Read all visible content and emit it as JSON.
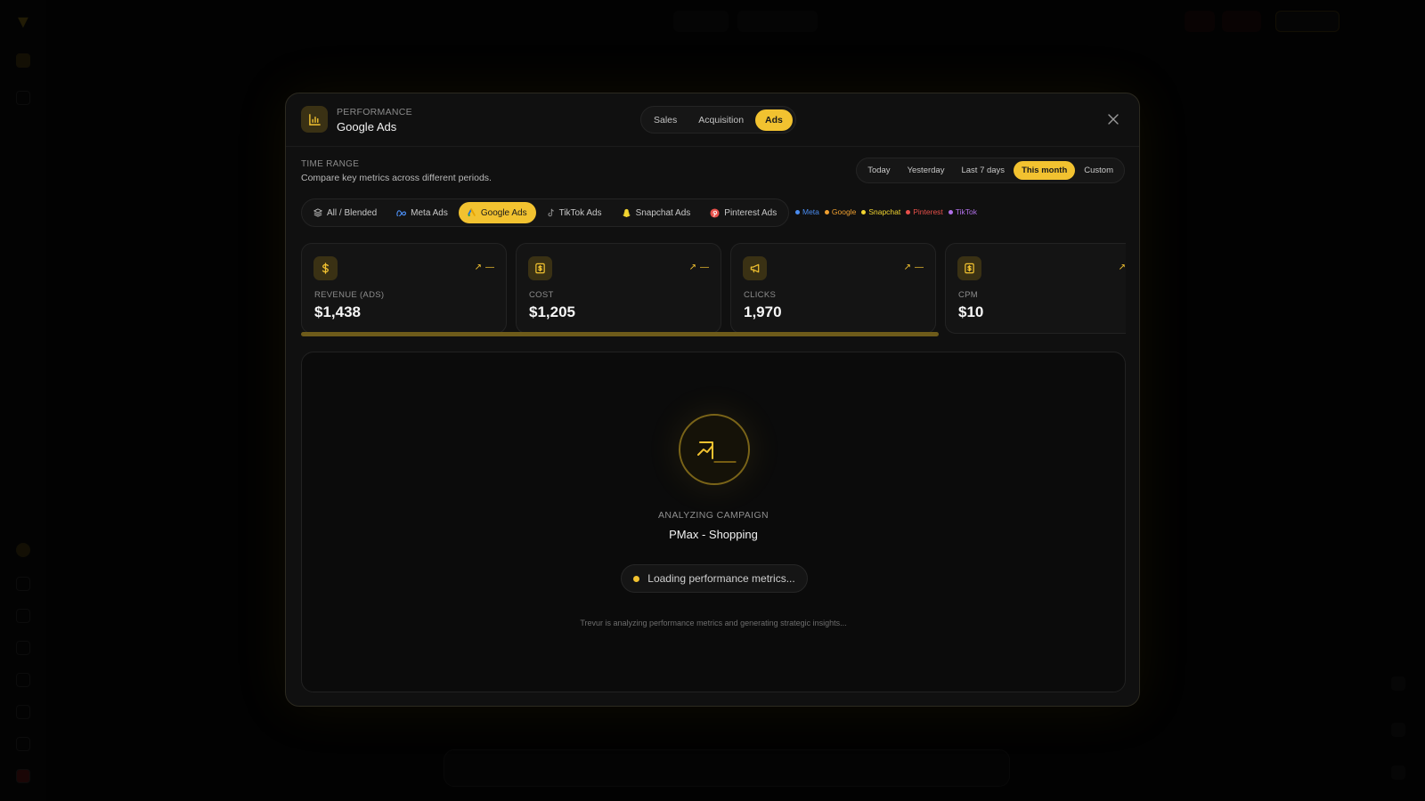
{
  "header": {
    "kicker": "PERFORMANCE",
    "title": "Google Ads",
    "tabs": [
      {
        "label": "Sales",
        "active": false
      },
      {
        "label": "Acquisition",
        "active": false
      },
      {
        "label": "Ads",
        "active": true
      }
    ]
  },
  "time_range": {
    "label": "TIME RANGE",
    "description": "Compare key metrics across different periods.",
    "options": [
      "Today",
      "Yesterday",
      "Last 7 days",
      "This month",
      "Custom"
    ],
    "selected": "This month"
  },
  "platforms": {
    "items": [
      {
        "label": "All / Blended",
        "icon": "layers-icon"
      },
      {
        "label": "Meta Ads",
        "icon": "meta-icon"
      },
      {
        "label": "Google Ads",
        "icon": "google-ads-icon"
      },
      {
        "label": "TikTok Ads",
        "icon": "tiktok-icon"
      },
      {
        "label": "Snapchat Ads",
        "icon": "snapchat-icon"
      },
      {
        "label": "Pinterest Ads",
        "icon": "pinterest-icon"
      }
    ],
    "selected": "Google Ads",
    "legend": [
      {
        "label": "Meta",
        "color": "#4a8cf0"
      },
      {
        "label": "Google",
        "color": "#f0a030"
      },
      {
        "label": "Snapchat",
        "color": "#f2d430"
      },
      {
        "label": "Pinterest",
        "color": "#e8504a"
      },
      {
        "label": "TikTok",
        "color": "#b070e8"
      }
    ]
  },
  "metrics": [
    {
      "label": "REVENUE (ADS)",
      "value": "$1,438",
      "trend": "—",
      "icon": "dollar-icon"
    },
    {
      "label": "COST",
      "value": "$1,205",
      "trend": "—",
      "icon": "receipt-icon"
    },
    {
      "label": "CLICKS",
      "value": "1,970",
      "trend": "—",
      "icon": "megaphone-icon"
    },
    {
      "label": "CPM",
      "value": "$10",
      "trend": "—",
      "icon": "receipt-icon"
    }
  ],
  "analysis": {
    "kicker": "ANALYZING CAMPAIGN",
    "campaign": "PMax - Shopping",
    "status": "Loading performance metrics...",
    "footnote": "Trevur is analyzing performance metrics and generating strategic insights..."
  },
  "colors": {
    "accent": "#f2c230",
    "background": "#050505",
    "modal": "#101010"
  }
}
